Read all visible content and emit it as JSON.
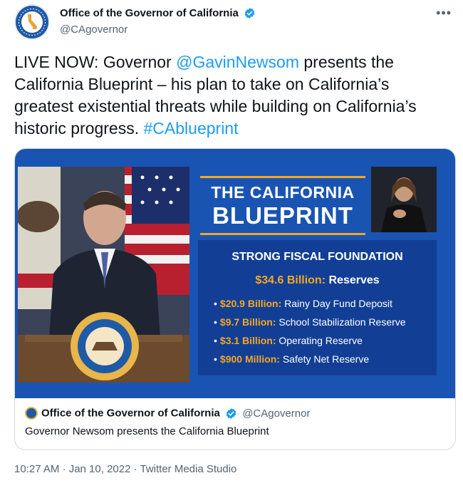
{
  "account": {
    "display_name": "Office of the Governor of California",
    "handle": "@CAgovernor",
    "avatar_icon": "california-seal-avatar",
    "verified_icon": "verified-badge-icon",
    "verified_color": "#1d9bf0"
  },
  "more_label": "•••",
  "tweet": {
    "part1": "LIVE NOW: Governor ",
    "mention": "@GavinNewsom",
    "part2": " presents the California Blueprint – his plan to take on California’s greatest existential threats while building on California’s historic progress. ",
    "hashtag": "#CAblueprint",
    "link_color": "#1d9bf0"
  },
  "media": {
    "title_line1": "THE CALIFORNIA",
    "title_line2": "BLUEPRINT",
    "panel_heading": "STRONG FISCAL FOUNDATION",
    "total_amount": "$34.6 Billion:",
    "total_label": "Reserves",
    "items": [
      {
        "amount": "$20.9 Billion:",
        "label": "Rainy Day Fund Deposit"
      },
      {
        "amount": "$9.7 Billion:",
        "label": "School Stabilization Reserve"
      },
      {
        "amount": "$3.1 Billion:",
        "label": "Operating Reserve"
      },
      {
        "amount": "$900 Million:",
        "label": "Safety Net Reserve"
      }
    ],
    "background_color": "#1a54b3",
    "accent_color": "#f5a623"
  },
  "card": {
    "author_name": "Office of the Governor of California",
    "author_handle": "@CAgovernor",
    "description": "Governor Newsom presents the California Blueprint"
  },
  "meta": {
    "line": "10:27 AM · Jan 10, 2022 · Twitter Media Studio"
  }
}
